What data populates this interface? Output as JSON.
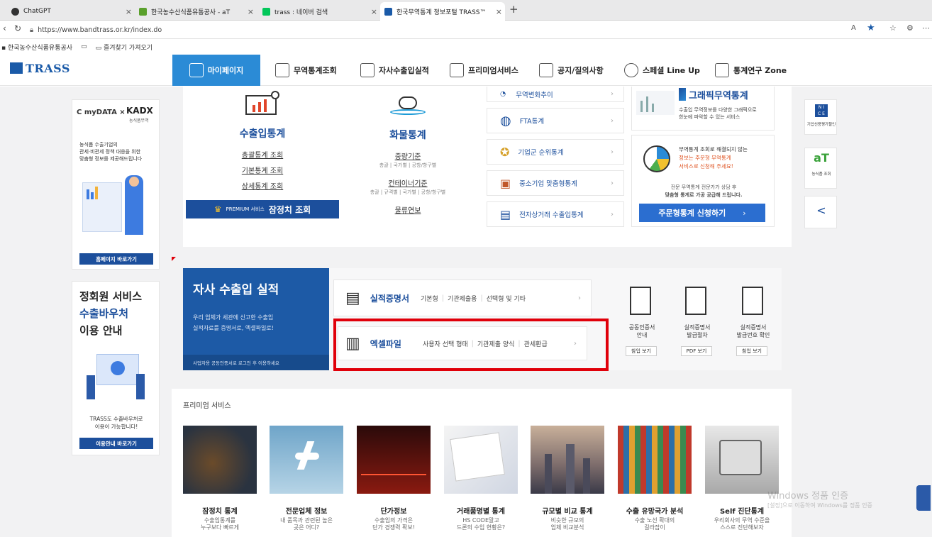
{
  "browser": {
    "tabs": [
      {
        "title": "ChatGPT"
      },
      {
        "title": "한국농수산식품유통공사 - aT"
      },
      {
        "title": "trass : 네이버 검색"
      },
      {
        "title": "한국무역통계 정보포털 TRASS™"
      }
    ],
    "url": "https://www.bandtrass.or.kr/index.do",
    "bookmarks": [
      "한국농수산식품유통공사",
      "즐겨찾기 가져오기"
    ]
  },
  "header": {
    "logo": "TRASS",
    "nav": [
      "마이페이지",
      "무역통계조회",
      "자사수출입실적",
      "프리미엄서비스",
      "공지/질의사항",
      "스페셜 Line Up",
      "통계연구 Zone"
    ]
  },
  "left_ads": {
    "ad1": {
      "logo_left": "myDATA",
      "logo_right": "KADX",
      "logo_right_sub": "농식품무역",
      "text1": "농식품 수출기업의",
      "text2": "관세·비관세 정책 대응을 위한",
      "text3": "맞춤형 정보를 제공해드립니다",
      "button": "홈페이지 바로가기"
    },
    "ad2": {
      "line1": "정회원 서비스",
      "line2": "수출바우처",
      "line3": "이용 안내",
      "text1": "TRASS도 수출바우처로",
      "text2": "이용이 가능합니다!",
      "button": "이용안내 바로가기"
    }
  },
  "stats": {
    "export_import": {
      "title": "수출입통계",
      "links": [
        "총괄통계 조회",
        "기본통계 조회",
        "상세통계 조회"
      ],
      "premium_label": "PREMIUM 서비스",
      "premium_title": "잠정치 조회"
    },
    "cargo": {
      "title": "화물통계",
      "weight": "중량기준",
      "weight_sub": "총괄 | 국가별 | 공항/항구별",
      "container": "컨테이너기준",
      "container_sub": "총괄 | 규격별 | 국가별 | 공항/항구별",
      "yearbook": "물류연보"
    },
    "menu": [
      "무역변화추이",
      "FTA통계",
      "기업군 순위통계",
      "중소기업 맞춤형통계",
      "전자상거래 수출입통계"
    ],
    "graphic": {
      "title": "그래픽무역통계",
      "desc1": "수출입 무역정보를 다양한 그래픽으로",
      "desc2": "한눈에 파악할 수 있는 서비스"
    },
    "custom": {
      "desc1": "무역통계 조회로 해결되지 않는",
      "desc2": "정보는 주문형 무역통계",
      "desc3": "서비스로 신청해 주세요!",
      "desc4": "전문 무역통계 전문가가 상담 후",
      "desc5": "맞춤형 통계로 가공 공급해 드립니다.",
      "button": "주문형통계 신청하기"
    }
  },
  "side_icons": [
    {
      "label": "기업신용평가할인"
    },
    {
      "label": "aT",
      "sub": "농식품 조회"
    },
    {
      "label": "share"
    }
  ],
  "own": {
    "title": "자사 수출입 실적",
    "desc1": "우리 업체가 세관에 신고한 수출입",
    "desc2": "실적자료를 증명서로, 엑셀파일로!",
    "note": "사업자용 공동인증서로 로그인 후 이용하세요",
    "rows": [
      {
        "title": "실적증명서",
        "items": [
          "기본형",
          "기관제출용",
          "선택형 및 기타"
        ]
      },
      {
        "title": "엑셀파일",
        "items": [
          "사용자 선택 형태",
          "기관제출 양식",
          "관세환급"
        ]
      }
    ],
    "docs": [
      {
        "t1": "공동인증서",
        "t2": "안내",
        "btn": "참업 보기"
      },
      {
        "t1": "실적증명서",
        "t2": "발급절차",
        "btn": "PDF 보기"
      },
      {
        "t1": "실적증명서",
        "t2": "발급번호 확인",
        "btn": "참업 보기"
      }
    ]
  },
  "premium": {
    "title": "프리미엄 서비스",
    "items": [
      {
        "name": "잠정치 통계",
        "sub1": "수출입통계를",
        "sub2": "누구보다 빠르게"
      },
      {
        "name": "전문업체 정보",
        "sub1": "내 품목과 관련된 높은",
        "sub2": "곳은 어디?"
      },
      {
        "name": "단가정보",
        "sub1": "수출입의 가격은",
        "sub2": "단가 경쟁력 확보!"
      },
      {
        "name": "거래품명별 통계",
        "sub1": "HS CODE말고",
        "sub2": "드론의 수입 현황은?"
      },
      {
        "name": "규모별 비교 통계",
        "sub1": "비슷한 규모의",
        "sub2": "업체 비교분석"
      },
      {
        "name": "수출 유망국가 분석",
        "sub1": "수출 노선 확대의",
        "sub2": "길라잡이"
      },
      {
        "name": "Self 진단통계",
        "sub1": "우리회사의 무역 수준을",
        "sub2": "스스로 진단해보자"
      }
    ]
  },
  "watermark": {
    "line1": "Windows 정품 인증",
    "line2": "[설정]으로 이동하여 Windows를 정품 인증"
  },
  "colors": {
    "nav_active": "#2b8bd6",
    "navy": "#1c4f9c",
    "highlight": "#e0000a"
  }
}
